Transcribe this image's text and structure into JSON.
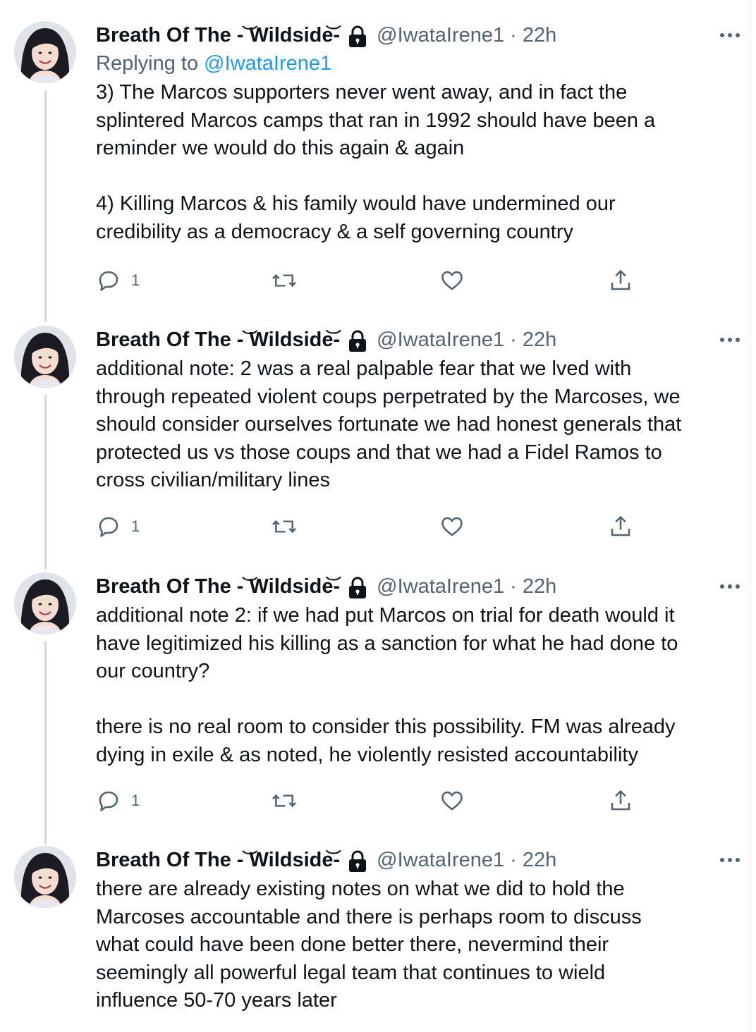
{
  "tweets": [
    {
      "display_name": "Breath Of The -͝ Wildside͝-",
      "handle": "@IwataIrene1",
      "separator": "·",
      "time": "22h",
      "replying_prefix": "Replying to ",
      "replying_handle": "@IwataIrene1",
      "text": "3) The Marcos supporters never went away, and in fact the\nsplintered Marcos camps that ran in 1992 should have been a\nreminder we would do this again & again\n\n4) Killing Marcos & his family would have undermined our\ncredibility as a democracy & a self governing country",
      "reply_count": "1"
    },
    {
      "display_name": "Breath Of The -͝ Wildside͝-",
      "handle": "@IwataIrene1",
      "separator": "·",
      "time": "22h",
      "text": "additional note: 2 was a real palpable fear that we lved with\nthrough repeated violent coups perpetrated by the Marcoses, we\nshould consider ourselves fortunate we had honest generals that\nprotected us vs those coups and that we had a Fidel Ramos to\ncross civilian/military lines",
      "reply_count": "1"
    },
    {
      "display_name": "Breath Of The -͝ Wildside͝-",
      "handle": "@IwataIrene1",
      "separator": "·",
      "time": "22h",
      "text": "additional note 2: if we had put Marcos on trial for death would it\nhave legitimized his killing as a sanction for what he had done to\nour country?\n\nthere is no real room to consider this possibility. FM was already\ndying in exile & as noted, he violently resisted accountability",
      "reply_count": "1"
    },
    {
      "display_name": "Breath Of The -͝ Wildside͝-",
      "handle": "@IwataIrene1",
      "separator": "·",
      "time": "22h",
      "text": "there are already existing notes on what we did to hold the\nMarcoses accountable and there is perhaps room to discuss\nwhat could have been done better there, nevermind their\nseemingly all powerful legal team that continues to wield\ninfluence 50-70 years later"
    }
  ],
  "icons": {
    "reply": "reply-icon",
    "retweet": "retweet-icon",
    "like": "heart-icon",
    "share": "share-icon",
    "more": "more-icon",
    "protected": "lock-icon"
  },
  "colors": {
    "text": "#0f1419",
    "secondary": "#536471",
    "link": "#1d9bf0",
    "thread_line": "#cfd9de",
    "avatar_hair": "#1c1a22",
    "avatar_bg": "#dfe3ea"
  }
}
